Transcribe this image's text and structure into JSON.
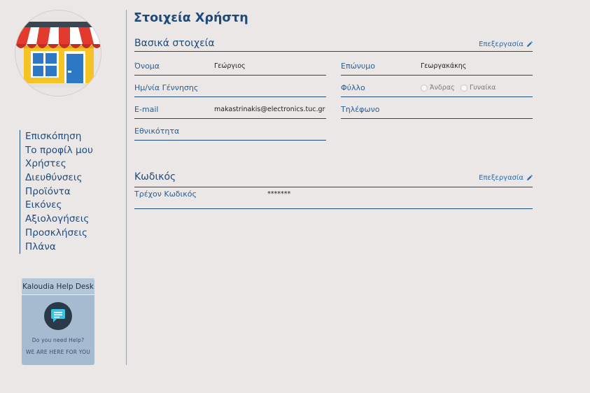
{
  "page": {
    "title": "Στοιχεία Χρήστη"
  },
  "sidebar": {
    "items": [
      {
        "label": "Επισκόπηση"
      },
      {
        "label": "Το προφίλ μου"
      },
      {
        "label": "Χρήστες"
      },
      {
        "label": "Διευθύνσεις"
      },
      {
        "label": "Προϊόντα"
      },
      {
        "label": "Εικόνες"
      },
      {
        "label": "Αξιολογήσεις"
      },
      {
        "label": "Προσκλήσεις"
      },
      {
        "label": "Πλάνα"
      }
    ]
  },
  "helpdesk": {
    "title": "Kaloudia Help Desk",
    "line1": "Do you need Help?",
    "line2": "WE ARE HERE FOR YOU",
    "icon": "chat-bubble-icon"
  },
  "basic": {
    "title": "Βασικά στοιχεία",
    "edit_label": "Επεξεργασία",
    "first_name": {
      "label": "Όνομα",
      "value": "Γεώργιος"
    },
    "last_name": {
      "label": "Επώνυμο",
      "value": "Γεωργακάκης"
    },
    "birthdate": {
      "label": "Ημ/νία Γέννησης",
      "value": ""
    },
    "gender": {
      "label": "Φύλλο",
      "male": "Άνδρας",
      "female": "Γυναίκα"
    },
    "email": {
      "label": "E-mail",
      "value": "makastrinakis@electronics.tuc.gr"
    },
    "phone": {
      "label": "Τηλέφωνο",
      "value": ""
    },
    "nationality": {
      "label": "Εθνικότητα",
      "value": ""
    }
  },
  "password": {
    "title": "Κωδικός",
    "edit_label": "Επεξεργασία",
    "current": {
      "label": "Τρέχον Κωδικός",
      "value": "*******"
    }
  },
  "colors": {
    "primary": "#1f4a7a",
    "link": "#2a6aa8",
    "background": "#ebe7e6",
    "helpdesk": "#a6bbd0"
  }
}
